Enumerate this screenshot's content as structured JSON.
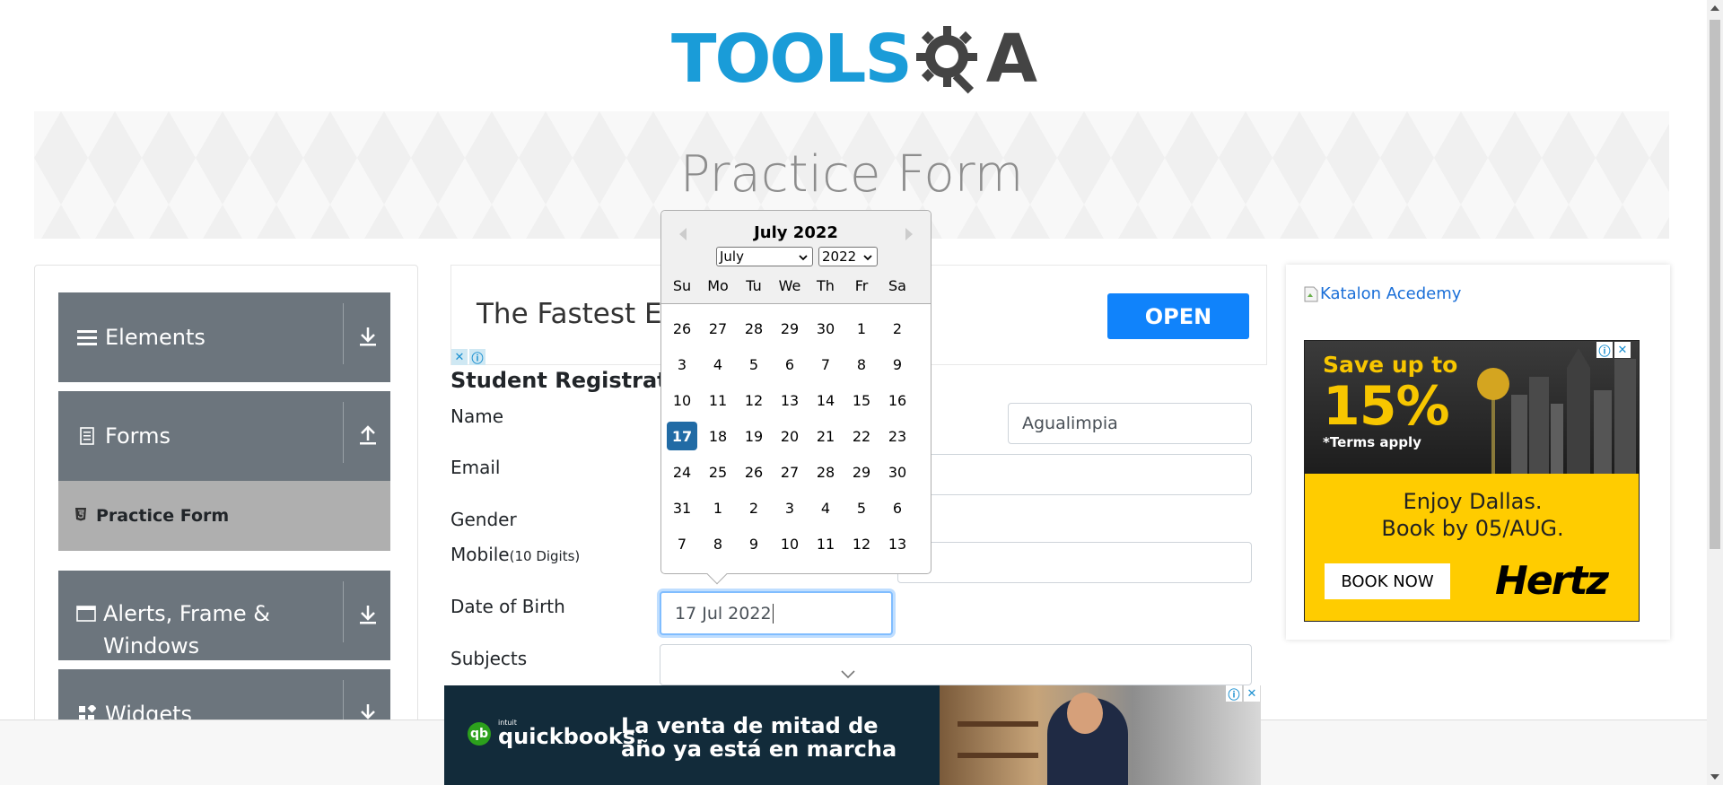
{
  "header": {
    "logo_tools": "TOOLS",
    "logo_qa": "A",
    "page_title": "Practice Form"
  },
  "sidebar": {
    "groups": [
      {
        "label": "Elements",
        "icon": "hamburger-icon",
        "arrow": "download-arrow-icon"
      },
      {
        "label": "Forms",
        "icon": "document-icon",
        "arrow": "upload-arrow-icon"
      },
      {
        "label": "Alerts, Frame & Windows",
        "icon": "window-icon",
        "arrow": "download-arrow-icon"
      },
      {
        "label": "Widgets",
        "icon": "widgets-icon",
        "arrow": "download-arrow-icon"
      }
    ],
    "active_item": "Practice Form"
  },
  "ad_top": {
    "text": "The Fastest Eve",
    "button": "OPEN"
  },
  "form": {
    "title": "Student Registration",
    "labels": {
      "name": "Name",
      "email": "Email",
      "gender": "Gender",
      "mobile": "Mobile",
      "mobile_hint": "(10 Digits)",
      "dob": "Date of Birth",
      "subjects": "Subjects"
    },
    "last_name_value": "Agualimpia",
    "dob_value": "17 Jul 2022"
  },
  "calendar": {
    "title": "July 2022",
    "month_select": "July",
    "year_select": "2022",
    "weekdays": [
      "Su",
      "Mo",
      "Tu",
      "We",
      "Th",
      "Fr",
      "Sa"
    ],
    "weeks": [
      [
        "26",
        "27",
        "28",
        "29",
        "30",
        "1",
        "2"
      ],
      [
        "3",
        "4",
        "5",
        "6",
        "7",
        "8",
        "9"
      ],
      [
        "10",
        "11",
        "12",
        "13",
        "14",
        "15",
        "16"
      ],
      [
        "17",
        "18",
        "19",
        "20",
        "21",
        "22",
        "23"
      ],
      [
        "24",
        "25",
        "26",
        "27",
        "28",
        "29",
        "30"
      ],
      [
        "31",
        "1",
        "2",
        "3",
        "4",
        "5",
        "6"
      ],
      [
        "7",
        "8",
        "9",
        "10",
        "11",
        "12",
        "13"
      ]
    ],
    "selected": "17"
  },
  "right_ad": {
    "katalon_alt": "Katalon Acedemy",
    "save": "Save up to",
    "percent": "15%",
    "terms": "*Terms apply",
    "enjoy_line1": "Enjoy Dallas.",
    "enjoy_line2": "Book by 05/AUG.",
    "book_button": "BOOK NOW",
    "brand": "Hertz"
  },
  "bottom_ad": {
    "intuit": "intuit",
    "brand": "quickbooks.",
    "line1": "La venta de mitad de",
    "line2": "año ya está en marcha"
  },
  "colors": {
    "brand_blue": "#1a9cd8",
    "sidebar_gray": "#6c757d",
    "selected_day": "#216ba5",
    "open_button": "#1083fb",
    "hertz_yellow": "#ffcc00"
  }
}
